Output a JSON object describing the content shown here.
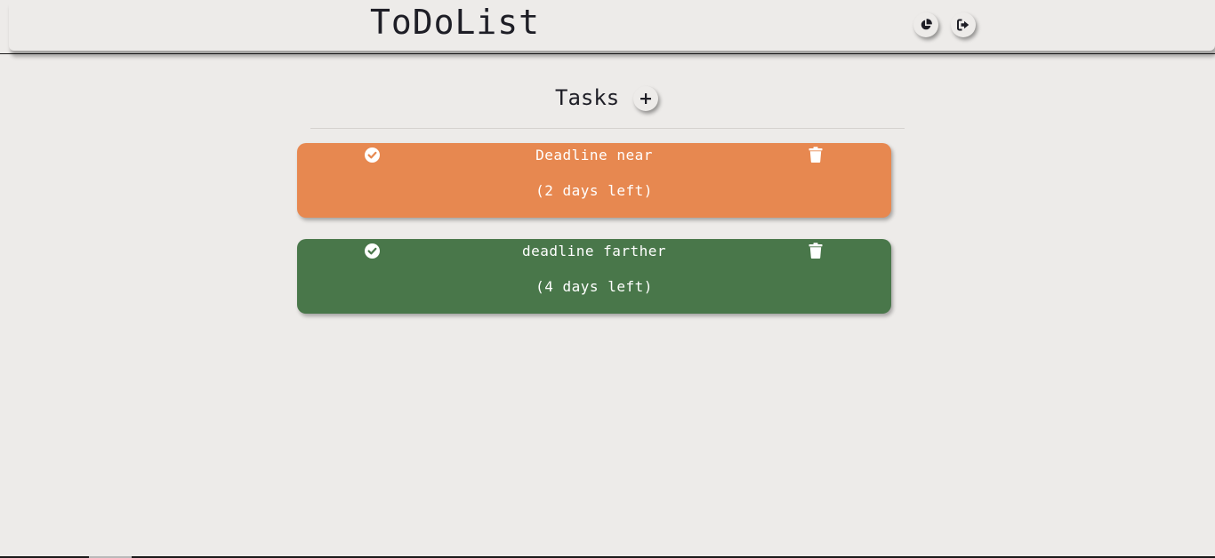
{
  "header": {
    "title": "ToDoList",
    "stats_icon": "pie-chart-icon",
    "logout_icon": "sign-out-icon"
  },
  "tasks_section": {
    "heading": "Tasks",
    "add_icon": "plus-icon"
  },
  "tasks": [
    {
      "name": "Deadline near",
      "days_left": "(2 days left)",
      "status": "near",
      "color": "#e78850",
      "done_icon": "check-circle-icon",
      "delete_icon": "trash-icon"
    },
    {
      "name": "deadline farther",
      "days_left": "(4 days left)",
      "status": "far",
      "color": "#49774a",
      "done_icon": "check-circle-icon",
      "delete_icon": "trash-icon"
    }
  ],
  "colors": {
    "background": "#edebe9",
    "text": "#1e1e26",
    "near_deadline": "#e78850",
    "far_deadline": "#49774a"
  }
}
